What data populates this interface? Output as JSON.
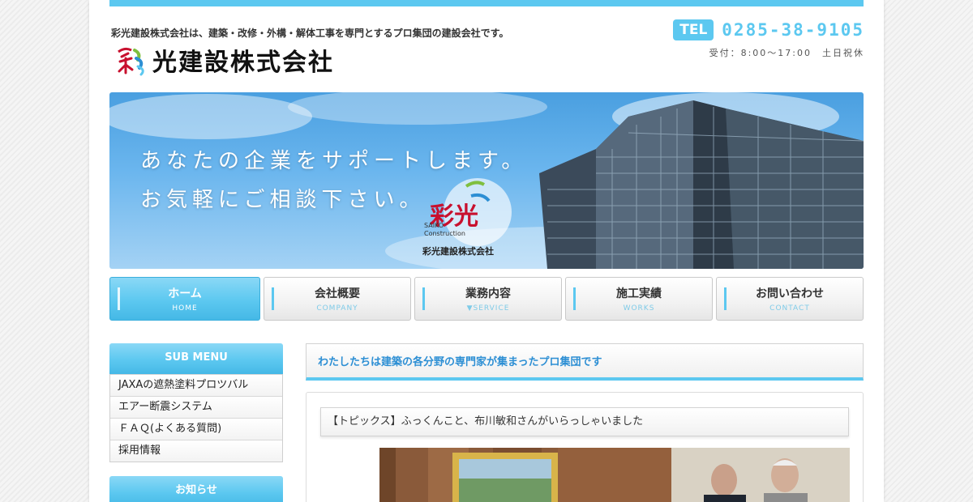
{
  "header": {
    "tagline": "彩光建設株式会社は、建築・改修・外構・解体工事を専門とするプロ集団の建設会社です。",
    "logo_text": "光建設株式会社",
    "tel_label": "TEL",
    "tel_number": "0285-38-9105",
    "hours": "受付：8:00〜17:00　土日祝休"
  },
  "hero": {
    "line1": "あなたの企業をサポートします。",
    "line2": "お気軽にご相談下さい。",
    "logo_kanji": "彩光",
    "logo_en1": "SAIKO",
    "logo_en2": "Construction",
    "logo_company": "彩光建設株式会社"
  },
  "nav": [
    {
      "ja": "ホーム",
      "en": "HOME"
    },
    {
      "ja": "会社概要",
      "en": "COMPANY"
    },
    {
      "ja": "業務内容",
      "en": "▼SERVICE"
    },
    {
      "ja": "施工実績",
      "en": "WORKS"
    },
    {
      "ja": "お問い合わせ",
      "en": "CONTACT"
    }
  ],
  "sidebar": {
    "submenu_title": "SUB MENU",
    "items": [
      "JAXAの遮熱塗料プロツバル",
      "エアー断震システム",
      "ＦＡＱ(よくある質問)",
      "採用情報"
    ],
    "news_title": "お知らせ"
  },
  "main": {
    "title": "わたしたちは建築の各分野の専門家が集まったプロ集団です",
    "topic": "【トピックス】ふっくんこと、布川敏和さんがいらっしゃいました"
  },
  "colors": {
    "accent": "#5cc8f0",
    "title_blue": "#2d8fd4"
  }
}
